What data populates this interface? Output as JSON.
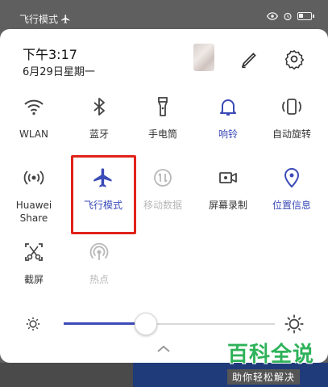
{
  "status_bar": {
    "left_text": "飞行模式"
  },
  "panel": {
    "time": "下午3:17",
    "date": "6月29日星期一"
  },
  "tiles": [
    {
      "label": "WLAN",
      "icon": "wifi-icon",
      "state": "off"
    },
    {
      "label": "蓝牙",
      "icon": "bluetooth-icon",
      "state": "off"
    },
    {
      "label": "手电筒",
      "icon": "flashlight-icon",
      "state": "off"
    },
    {
      "label": "响铃",
      "icon": "bell-icon",
      "state": "on"
    },
    {
      "label": "自动旋转",
      "icon": "rotate-icon",
      "state": "off"
    },
    {
      "label": "Huawei Share",
      "icon": "huawei-share-icon",
      "state": "off"
    },
    {
      "label": "飞行模式",
      "icon": "airplane-icon",
      "state": "on"
    },
    {
      "label": "移动数据",
      "icon": "mobile-data-icon",
      "state": "disabled"
    },
    {
      "label": "屏幕录制",
      "icon": "screen-record-icon",
      "state": "off"
    },
    {
      "label": "位置信息",
      "icon": "location-icon",
      "state": "on"
    },
    {
      "label": "截屏",
      "icon": "screenshot-icon",
      "state": "off"
    },
    {
      "label": "热点",
      "icon": "hotspot-icon",
      "state": "disabled"
    }
  ],
  "brightness": {
    "level": 0.39
  },
  "colors": {
    "accent": "#3b4bb7",
    "highlight": "#e0231b",
    "disabled": "#b8b8b8"
  },
  "watermark": {
    "title": "百科全说",
    "subtitle": "助你轻松解决"
  }
}
